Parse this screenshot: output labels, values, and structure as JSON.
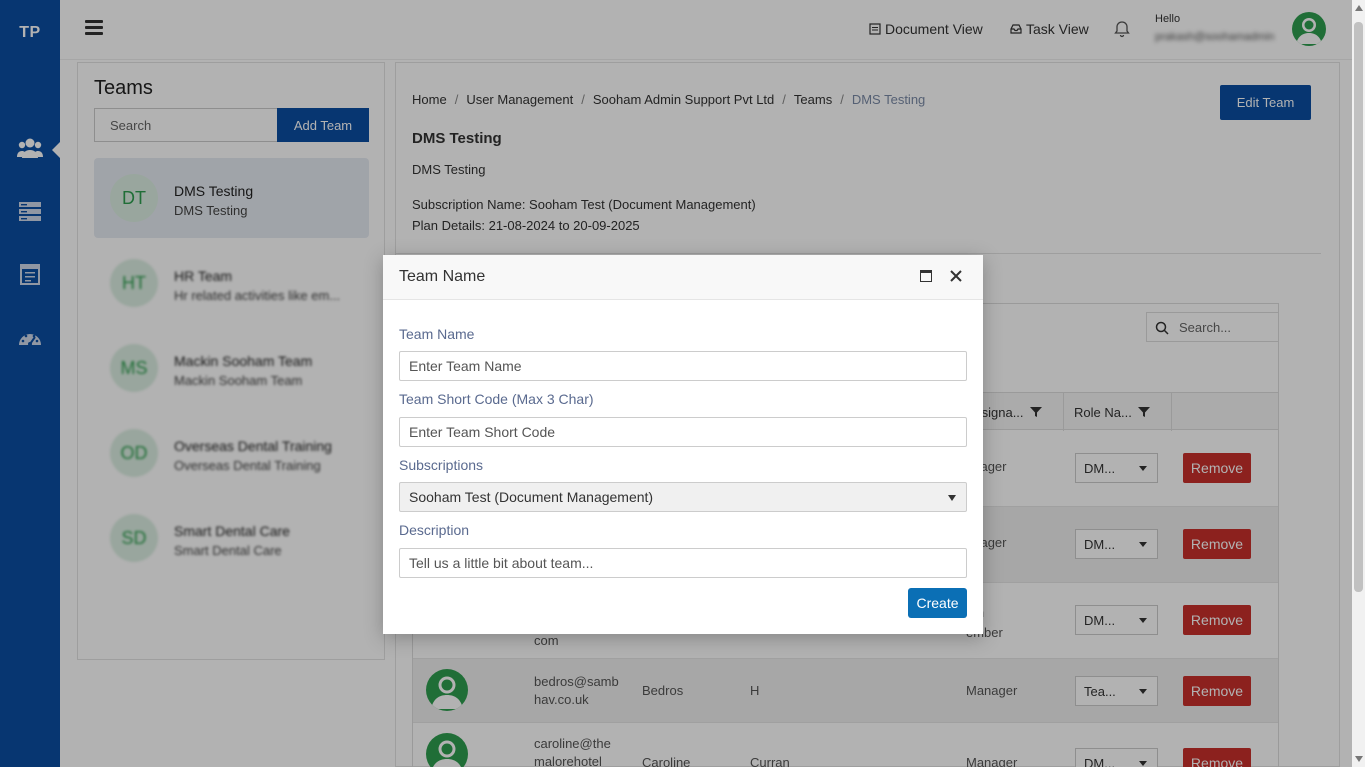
{
  "app": {
    "logo_text": "TP"
  },
  "header": {
    "document_view_label": "Document View",
    "task_view_label": "Task View",
    "hello_label": "Hello",
    "user_email": "prakash@soohamadmin"
  },
  "sidebar": {
    "icons": [
      "users-icon",
      "list-icon",
      "calendar-icon",
      "dashboard-icon"
    ]
  },
  "teams_panel": {
    "title": "Teams",
    "search_placeholder": "Search",
    "add_team_label": "Add Team",
    "teams": [
      {
        "initials": "DT",
        "name": "DMS Testing",
        "description": "DMS Testing"
      },
      {
        "initials": "HT",
        "name": "HR Team",
        "description": "Hr related activities like em..."
      },
      {
        "initials": "MS",
        "name": "Mackin Sooham Team",
        "description": "Mackin Sooham Team"
      },
      {
        "initials": "OD",
        "name": "Overseas Dental Training",
        "description": "Overseas Dental Training"
      },
      {
        "initials": "SD",
        "name": "Smart Dental Care",
        "description": "Smart Dental Care"
      }
    ]
  },
  "main": {
    "breadcrumb": [
      "Home",
      "User Management",
      "Sooham Admin Support Pvt Ltd",
      "Teams",
      "DMS Testing"
    ],
    "edit_team_label": "Edit Team",
    "team_title": "DMS Testing",
    "team_description": "DMS Testing",
    "subscription_text": "Subscription Name: Sooham Test (Document Management)",
    "plan_text": "Plan Details: 21-08-2024 to 20-09-2025",
    "grid": {
      "search_placeholder": "Search...",
      "columns": [
        "Designa...",
        "Role Na..."
      ],
      "rows": [
        {
          "email": "",
          "first": "",
          "last": "",
          "designation": "anager",
          "role": "DM...",
          "remove": "Remove"
        },
        {
          "email": "",
          "first": "",
          "last": "",
          "designation": "anager",
          "role": "DM...",
          "remove": "Remove"
        },
        {
          "email": "com",
          "first": "",
          "last": "",
          "designation": "am\nember",
          "role": "DM...",
          "remove": "Remove"
        },
        {
          "email": "bedros@sambhav.co.uk",
          "first": "Bedros",
          "last": "H",
          "designation": "Manager",
          "role": "Tea...",
          "remove": "Remove"
        },
        {
          "email": "caroline@themalorehotel",
          "first": "Caroline",
          "last": "Curran",
          "designation": "Manager",
          "role": "DM...",
          "remove": "Remove"
        }
      ]
    }
  },
  "modal": {
    "title": "Team Name",
    "team_name_label": "Team Name",
    "team_name_placeholder": "Enter Team Name",
    "short_code_label": "Team Short Code (Max 3 Char)",
    "short_code_placeholder": "Enter Team Short Code",
    "subscriptions_label": "Subscriptions",
    "subscription_value": "Sooham Test (Document Management)",
    "description_label": "Description",
    "description_placeholder": "Tell us a little bit about team...",
    "create_label": "Create"
  },
  "colors": {
    "primary": "#0b4ea2",
    "remove": "#c9302c",
    "avatar_green": "#2e9e4f",
    "create": "#0b6fb5"
  }
}
